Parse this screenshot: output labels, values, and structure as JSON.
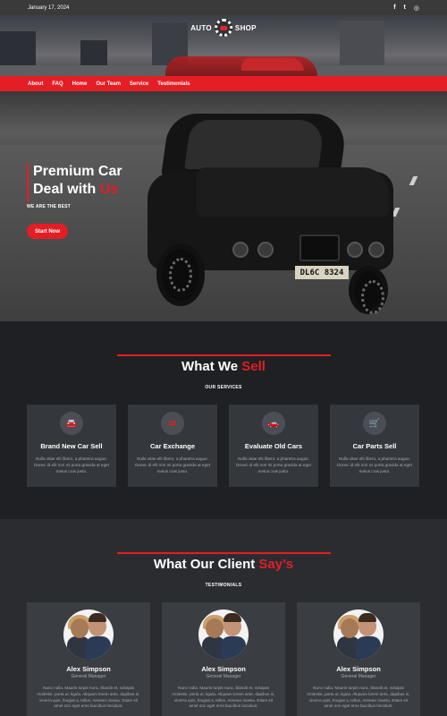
{
  "topbar": {
    "date": "January 17, 2024",
    "social": [
      {
        "icon": "facebook-icon",
        "glyph": "f"
      },
      {
        "icon": "twitter-icon",
        "glyph": "t"
      },
      {
        "icon": "instagram-icon",
        "glyph": "◎"
      }
    ]
  },
  "brand": {
    "left": "AUTO",
    "right": "SHOP"
  },
  "nav": {
    "items": [
      {
        "label": "About"
      },
      {
        "label": "FAQ"
      },
      {
        "label": "Home"
      },
      {
        "label": "Our Team"
      },
      {
        "label": "Service"
      },
      {
        "label": "Testimonials"
      }
    ]
  },
  "hero": {
    "title_line1": "Premium Car",
    "title_line2_prefix": "Deal with ",
    "title_line2_highlight": "Us",
    "subtitle": "WE ARE THE BEST",
    "button_label": "Start Now",
    "plate": "DL6C 8324"
  },
  "services": {
    "title_prefix": "What We ",
    "title_highlight": "Sell",
    "subtitle": "OUR SERVICES",
    "cards": [
      {
        "icon": "car-icon",
        "glyph": "🚘",
        "title": "Brand New Car Sell",
        "text": "Nulla vitae elit libero, a pharetra augue. Donec id elit non mi porta gravida at eget metus cras justo."
      },
      {
        "icon": "exchange-icon",
        "glyph": "⇄",
        "title": "Car Exchange",
        "text": "Nulla vitae elit libero, a pharetra augue. Donec id elit non mi porta gravida at eget metus cras justo."
      },
      {
        "icon": "car-evaluate-icon",
        "glyph": "🚗",
        "title": "Evaluate Old Cars",
        "text": "Nulla vitae elit libero, a pharetra augue. Donec id elit non mi porta gravida at eget metus cras justo."
      },
      {
        "icon": "cart-icon",
        "glyph": "🛒",
        "title": "Car Parts Sell",
        "text": "Nulla vitae elit libero, a pharetra augue. Donec id elit non mi porta gravida at eget metus cras justo."
      }
    ]
  },
  "testimonials": {
    "title_prefix": "What Our Client ",
    "title_highlight": "Say’s",
    "subtitle": "TESTIMONIALS",
    "cards": [
      {
        "name": "Alex Simpson",
        "role": "General Manager",
        "text": "Nunc nulla. Mauris turpis nunc, blandit et, volutpat molestie, porta ut, ligula. Aliquam lorem ante, dapibus in, viverra quis, feugiat a, tellus. Aenean massa. Etiam sit amet orci eget eros faucibus tincidunt."
      },
      {
        "name": "Alex Simpson",
        "role": "General Manager",
        "text": "Nunc nulla. Mauris turpis nunc, blandit et, volutpat molestie, porta ut, ligula. Aliquam lorem ante, dapibus in, viverra quis, feugiat a, tellus. Aenean massa. Etiam sit amet orci eget eros faucibus tincidunt."
      },
      {
        "name": "Alex Simpson",
        "role": "General Manager",
        "text": "Nunc nulla. Mauris turpis nunc, blandit et, volutpat molestie, porta ut, ligula. Aliquam lorem ante, dapibus in, viverra quis, feugiat a, tellus. Aenean massa. Etiam sit amet orci eget eros faucibus tincidunt."
      }
    ]
  },
  "colors": {
    "accent": "#e51d24",
    "background": "#1e2023",
    "card": "#34373c",
    "topbar": "#3a3a3a"
  }
}
